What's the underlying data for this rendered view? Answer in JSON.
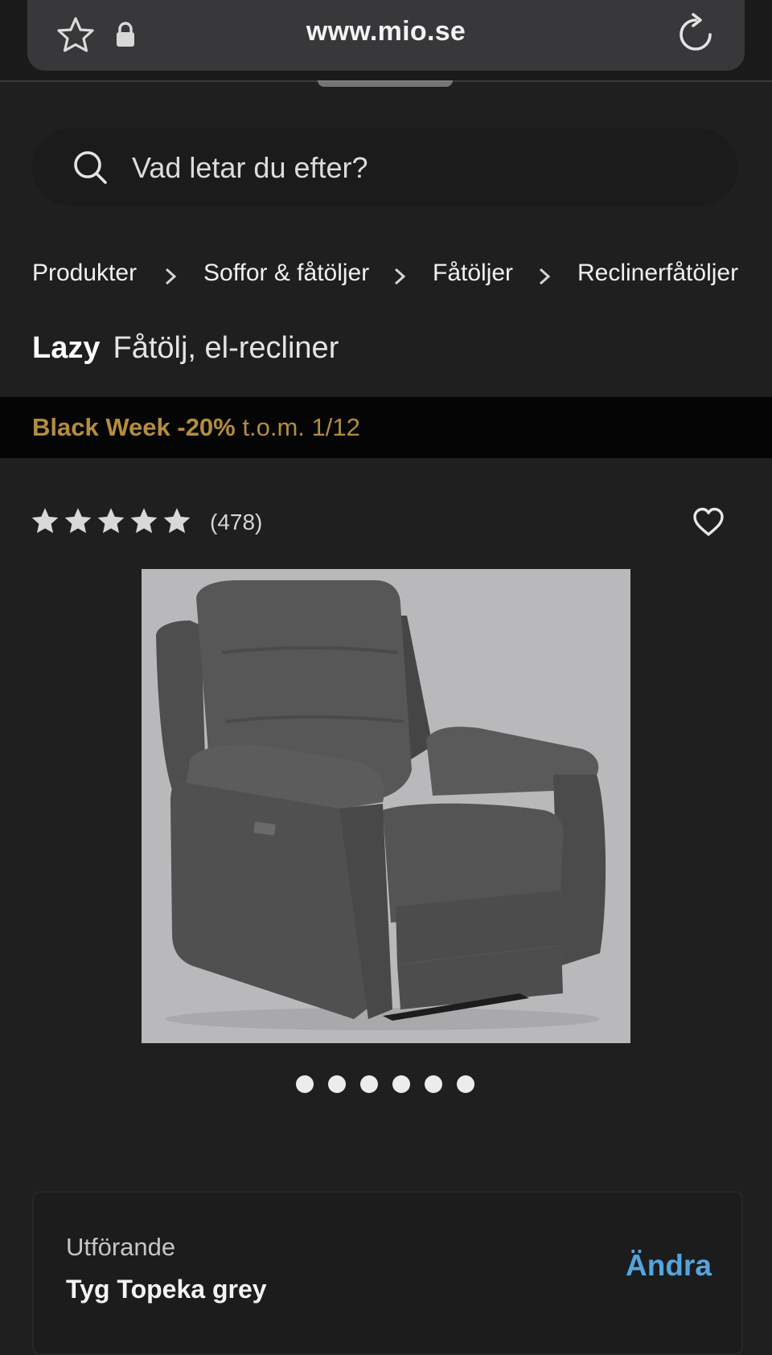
{
  "browser": {
    "url": "www.mio.se"
  },
  "search": {
    "placeholder": "Vad letar du efter?"
  },
  "breadcrumb": [
    "Produkter",
    "Soffor & fåtöljer",
    "Fåtöljer",
    "Reclinerfåtöljer"
  ],
  "product": {
    "brand": "Lazy",
    "subtitle": "Fåtölj, el-recliner"
  },
  "promo": {
    "strong": "Black Week -20%",
    "light": "t.o.m. 1/12",
    "color": "#b48d3e"
  },
  "rating": {
    "stars": 5,
    "max": 5,
    "count": "(478)"
  },
  "carousel": {
    "total": 6,
    "current": 1
  },
  "variant": {
    "label": "Utförande",
    "value": "Tyg Topeka grey",
    "action": "Ändra",
    "action_color": "#53a6dc"
  },
  "icons": [
    "star-outline-icon",
    "lock-icon",
    "reload-icon",
    "search-icon",
    "chevron-right-icon",
    "heart-icon"
  ]
}
